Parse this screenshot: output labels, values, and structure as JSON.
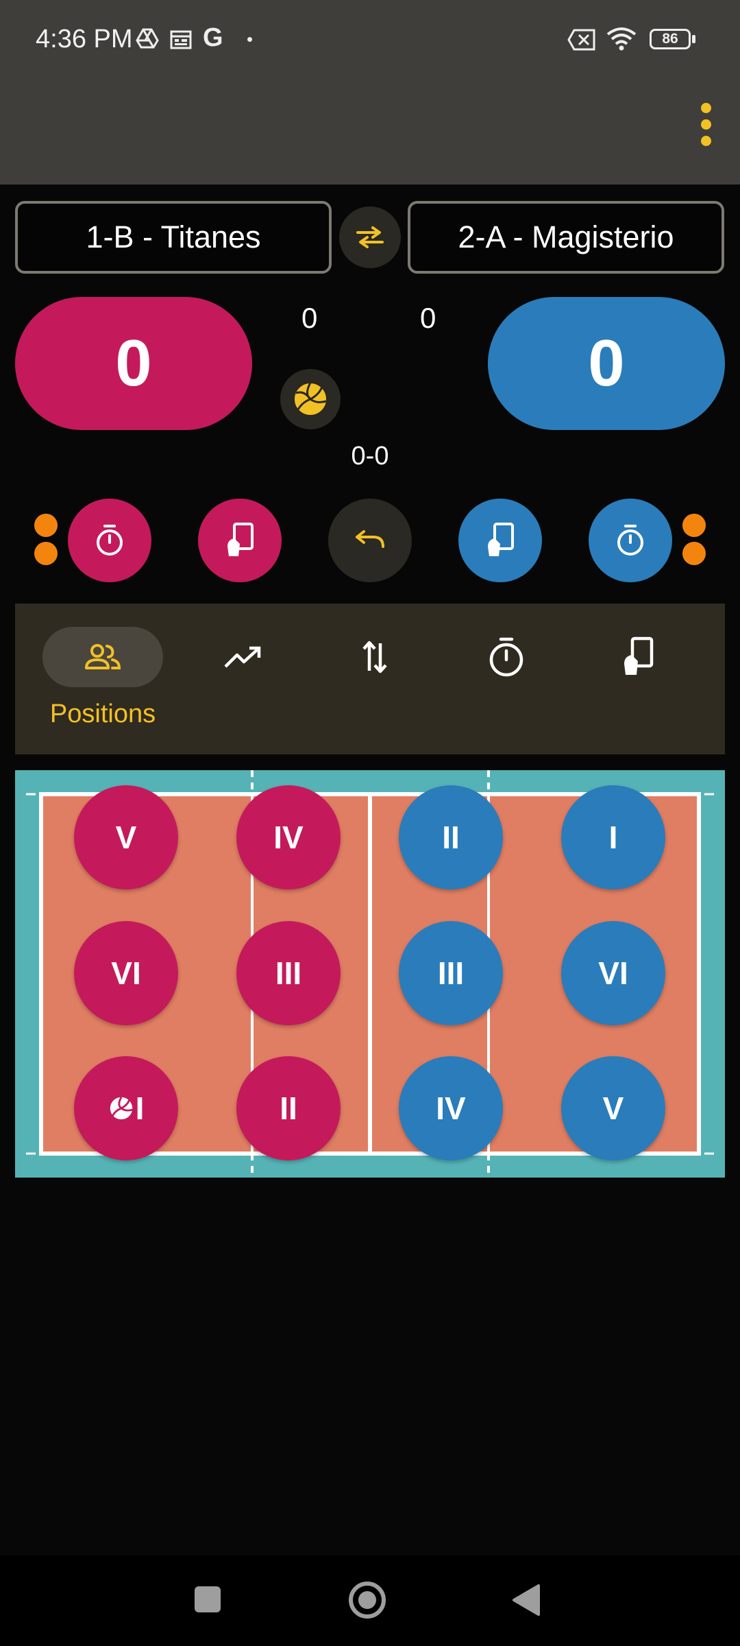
{
  "status_bar": {
    "time": "4:36 PM",
    "battery": "86",
    "icons": [
      "drive-icon",
      "calendar-icon",
      "google-icon",
      "dot-icon",
      "no-sim-icon",
      "wifi-icon",
      "battery-icon"
    ]
  },
  "app_bar": {
    "menu_icon": "more-vert-icon"
  },
  "teams": {
    "left": {
      "name": "1-B - Titanes",
      "score": "0",
      "sets": "0",
      "color": "#c41a5b"
    },
    "right": {
      "name": "2-A - Magisterio",
      "score": "0",
      "sets": "0",
      "color": "#2a7dba"
    },
    "swap_icon": "swap-icon",
    "serve_icon": "volleyball-icon",
    "set_score": "0-0"
  },
  "actions": {
    "left_timeouts_remaining": 2,
    "right_timeouts_remaining": 2,
    "buttons": [
      "timeout-icon",
      "card-icon",
      "undo-icon",
      "card-icon",
      "timeout-icon"
    ]
  },
  "tabs": [
    {
      "label": "Positions",
      "icon": "people-icon",
      "active": true
    },
    {
      "label": "",
      "icon": "trending-up-icon",
      "active": false
    },
    {
      "label": "",
      "icon": "swap-vert-icon",
      "active": false
    },
    {
      "label": "",
      "icon": "timeout-icon",
      "active": false
    },
    {
      "label": "",
      "icon": "card-icon",
      "active": false
    }
  ],
  "court": {
    "left_team": {
      "rows": [
        [
          "V",
          "IV"
        ],
        [
          "VI",
          "III"
        ],
        [
          "I",
          "II"
        ]
      ],
      "server": "I"
    },
    "right_team": {
      "rows": [
        [
          "II",
          "I"
        ],
        [
          "III",
          "VI"
        ],
        [
          "IV",
          "V"
        ]
      ]
    },
    "colors": {
      "outside": "#55b3b6",
      "inside": "#e07e63",
      "lines": "#ffffff"
    }
  },
  "nav_bar": {
    "icons": [
      "recents-icon",
      "home-icon",
      "back-icon"
    ]
  }
}
